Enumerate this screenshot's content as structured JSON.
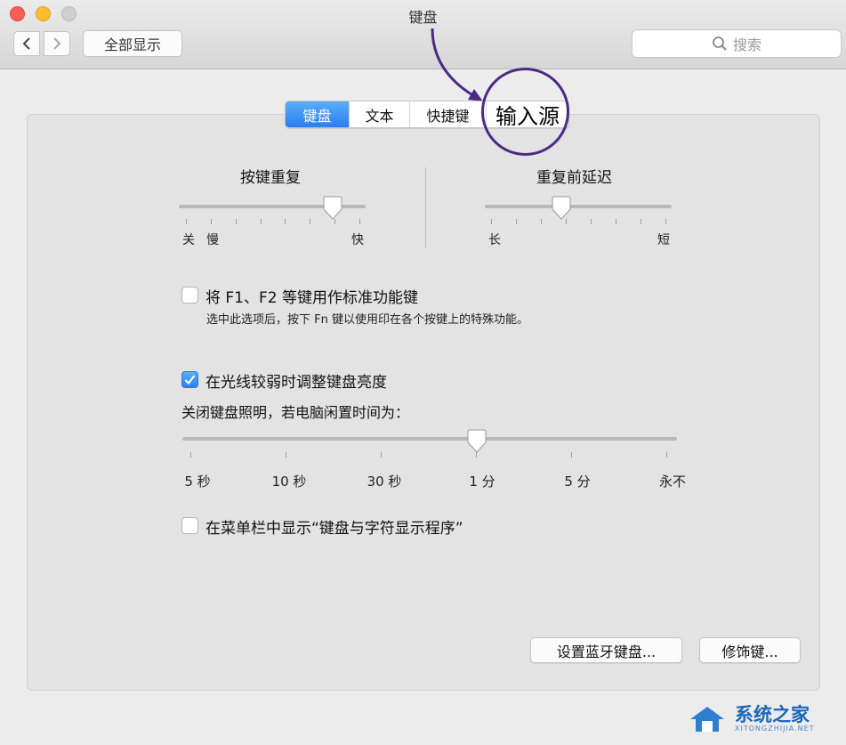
{
  "window": {
    "title": "键盘"
  },
  "toolbar": {
    "show_all": "全部显示",
    "search_placeholder": "搜索"
  },
  "tabs": [
    {
      "label": "键盘",
      "active": true
    },
    {
      "label": "文本",
      "active": false
    },
    {
      "label": "快捷键",
      "active": false
    },
    {
      "label": "输入源",
      "active": false
    }
  ],
  "key_repeat": {
    "title": "按键重复",
    "labels": [
      "关",
      "慢",
      "快"
    ],
    "value": 0.83
  },
  "delay_until_repeat": {
    "title": "重复前延迟",
    "labels": [
      "长",
      "短"
    ],
    "value": 0.41
  },
  "fn_keys": {
    "checked": false,
    "label": "将 F1、F2 等键用作标准功能键",
    "description": "选中此选项后，按下 Fn 键以使用印在各个按键上的特殊功能。"
  },
  "backlight": {
    "checked": true,
    "label": "在光线较弱时调整键盘亮度",
    "idle_label": "关闭键盘照明，若电脑闲置时间为：",
    "idle_ticks": [
      "5 秒",
      "10 秒",
      "30 秒",
      "1 分",
      "5 分",
      "永不"
    ],
    "idle_value": "1 分"
  },
  "menubar_viewer": {
    "checked": false,
    "label": "在菜单栏中显示“键盘与字符显示程序”"
  },
  "buttons": {
    "bluetooth": "设置蓝牙键盘...",
    "modifier": "修饰键..."
  },
  "watermark": {
    "text": "系统之家",
    "sub": "XITONGZHIJIA.NET"
  },
  "colors": {
    "accent": "#2a7ef0",
    "annotation": "#4b2a84"
  }
}
